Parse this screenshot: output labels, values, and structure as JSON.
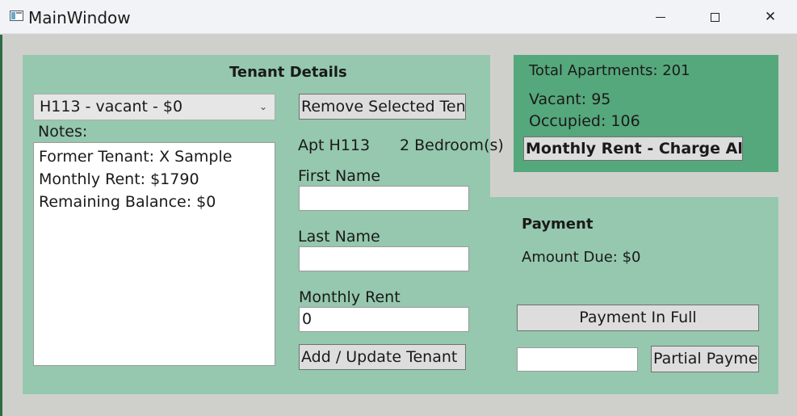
{
  "window": {
    "title": "MainWindow",
    "icons": {
      "app": "window-app-icon",
      "minimize": "minimize-icon",
      "maximize": "maximize-icon",
      "close": "close-icon"
    },
    "close_glyph": "✕"
  },
  "tenant_details": {
    "heading": "Tenant Details",
    "apartment_selector": {
      "selected": "H113 - vacant - $0",
      "arrow": "⌄"
    },
    "notes_label": "Notes:",
    "notes": [
      "Former Tenant: X Sample",
      "Monthly Rent: $1790",
      "Remaining Balance: $0"
    ],
    "remove_button": "Remove Selected Tenant",
    "apt_label": "Apt H113",
    "bedrooms_label": "2 Bedroom(s)",
    "first_name_label": "First Name",
    "first_name_value": "",
    "last_name_label": "Last Name",
    "last_name_value": "",
    "monthly_rent_label": "Monthly Rent",
    "monthly_rent_value": "0",
    "add_update_button": "Add / Update Tenant"
  },
  "summary": {
    "total": "Total Apartments: 201",
    "vacant": "Vacant: 95",
    "occupied": "Occupied: 106",
    "charge_button": "Monthly Rent - Charge All Tenants"
  },
  "payment": {
    "heading": "Payment",
    "amount_due": "Amount Due: $0",
    "full_button": "Payment In Full",
    "partial_value": "",
    "partial_button": "Partial Payment"
  },
  "colors": {
    "panel_light": "#95c8ae",
    "panel_dark": "#55a87c",
    "window_bg": "#cfd0cc"
  }
}
